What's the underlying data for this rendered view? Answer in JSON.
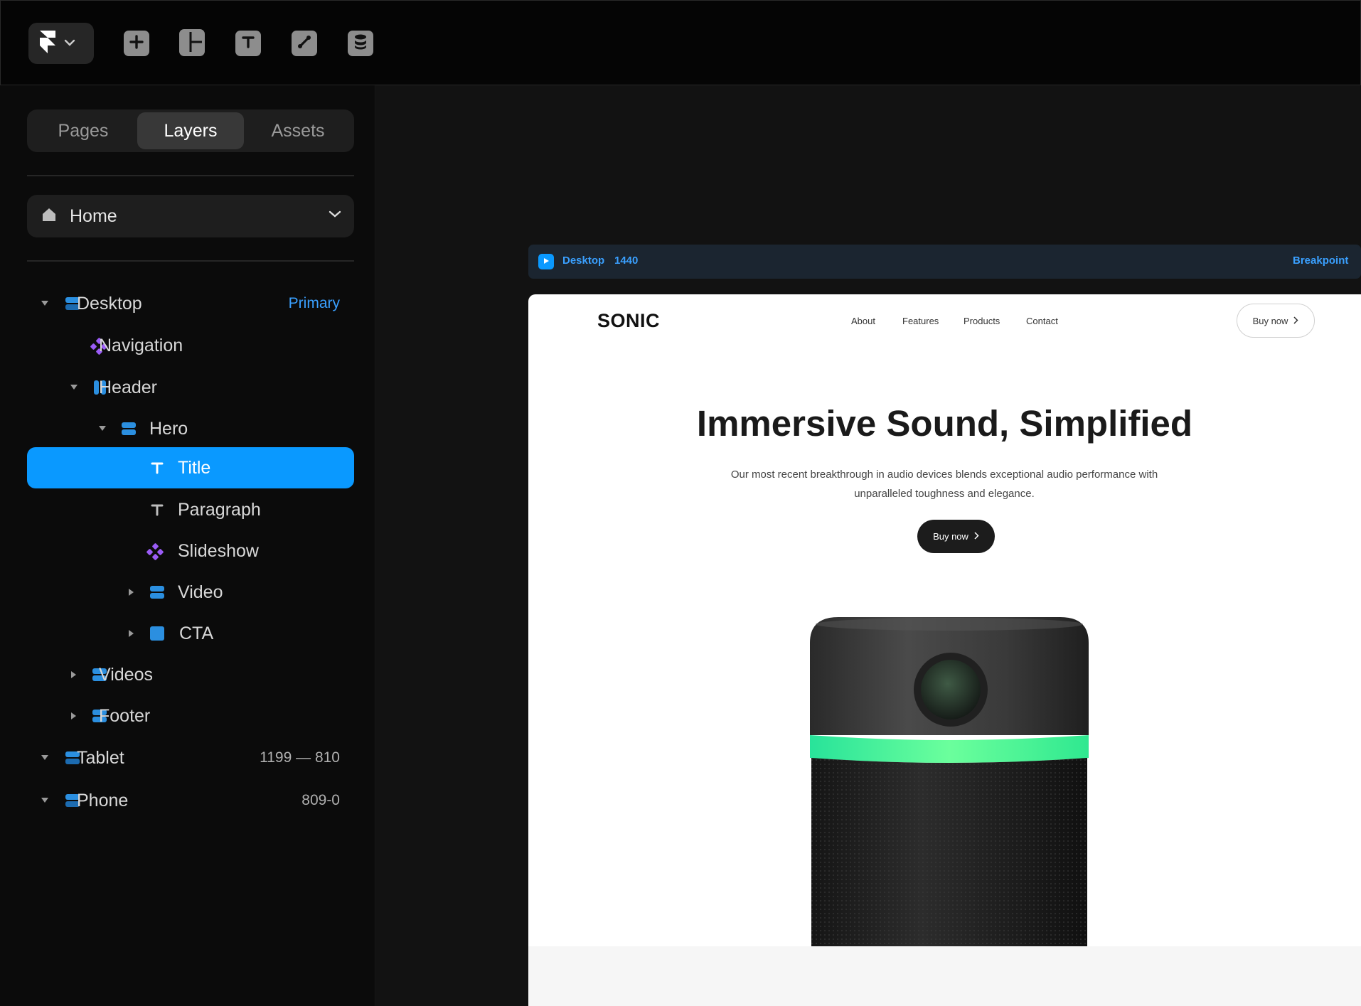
{
  "toolbar": {
    "logo_icon": "framer-logo-icon",
    "tools": [
      "add-icon",
      "layout-icon",
      "text-icon",
      "link-icon",
      "database-icon"
    ]
  },
  "sidebar": {
    "tabs": [
      {
        "label": "Pages",
        "active": false
      },
      {
        "label": "Layers",
        "active": true
      },
      {
        "label": "Assets",
        "active": false
      }
    ],
    "page_select": {
      "label": "Home"
    },
    "layers": [
      {
        "name": "Desktop",
        "meta": "Primary",
        "icon": "stack-icon",
        "selected": false
      },
      {
        "name": "Navigation",
        "meta": "",
        "icon": "component-icon",
        "selected": false
      },
      {
        "name": "Header",
        "meta": "",
        "icon": "columns-icon",
        "selected": false
      },
      {
        "name": "Hero",
        "meta": "",
        "icon": "stack-icon",
        "selected": false
      },
      {
        "name": "Title",
        "meta": "",
        "icon": "text-icon",
        "selected": true
      },
      {
        "name": "Paragraph",
        "meta": "",
        "icon": "text-icon",
        "selected": false
      },
      {
        "name": "Slideshow",
        "meta": "",
        "icon": "component-icon",
        "selected": false
      },
      {
        "name": "Video",
        "meta": "",
        "icon": "stack-icon",
        "selected": false
      },
      {
        "name": "CTA",
        "meta": "",
        "icon": "frame-icon",
        "selected": false
      },
      {
        "name": "Videos",
        "meta": "",
        "icon": "stack-icon",
        "selected": false
      },
      {
        "name": "Footer",
        "meta": "",
        "icon": "stack-icon",
        "selected": false
      },
      {
        "name": "Tablet",
        "meta": "1199 — 810",
        "icon": "stack-icon",
        "selected": false
      },
      {
        "name": "Phone",
        "meta": "809-0",
        "icon": "stack-icon",
        "selected": false
      }
    ]
  },
  "canvas": {
    "breakpoint_bar": {
      "name": "Desktop",
      "width": "1440",
      "action": "Breakpoint"
    },
    "site": {
      "logo": "SONIC",
      "nav": [
        "About",
        "Features",
        "Products",
        "Contact"
      ],
      "buy_outline_label": "Buy now",
      "hero_title": "Immersive Sound, Simplified",
      "hero_paragraph": "Our most recent breakthrough in audio devices blends exceptional audio performance with unparalleled toughness and elegance.",
      "buy_dark_label": "Buy now"
    }
  },
  "colors": {
    "accent": "#0a99ff",
    "component": "#9b5cf6",
    "speaker_band": "#3df5a0"
  }
}
